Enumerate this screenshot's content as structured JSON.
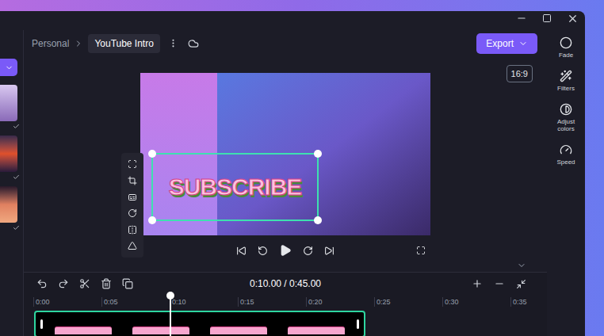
{
  "breadcrumb": [
    {
      "label": "Personal",
      "selected": false
    },
    {
      "label": "YouTube Intro",
      "selected": true
    }
  ],
  "export_button": {
    "label": "Export"
  },
  "right_panel": [
    {
      "label": "Fade"
    },
    {
      "label": "Filters"
    },
    {
      "label": "Adjust colors"
    },
    {
      "label": "Speed"
    }
  ],
  "aspect_ratio": "16:9",
  "sticker": {
    "text": "SUBSCRIBE",
    "selected": true
  },
  "media_sidebar": [
    {
      "checked": true
    },
    {
      "checked": true
    },
    {
      "checked": true
    }
  ],
  "timecode": "0:10.00 / 0:45.00",
  "ruler": [
    "0:00",
    "0:05",
    "0:10",
    "0:15",
    "0:20",
    "0:25",
    "0:30",
    "0:35"
  ],
  "playhead": {
    "level": 0.2222
  },
  "clip": {
    "selected": true
  }
}
